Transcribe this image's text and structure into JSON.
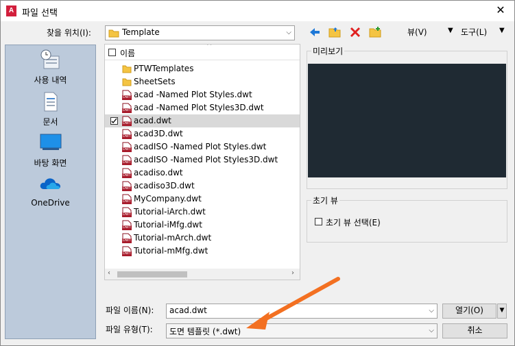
{
  "title": "파일 선택",
  "app_icon_text": "A",
  "lookin": {
    "label": "찾을 위치(I):",
    "value": "Template"
  },
  "toolbar": {
    "view_label": "뷰(V)",
    "tools_label": "도구(L)"
  },
  "sidebar": [
    {
      "label": "사용 내역",
      "icon": "history-icon"
    },
    {
      "label": "문서",
      "icon": "documents-icon"
    },
    {
      "label": "바탕 화면",
      "icon": "desktop-icon"
    },
    {
      "label": "OneDrive",
      "icon": "onedrive-icon"
    }
  ],
  "filelist": {
    "header": "이름",
    "items": [
      {
        "name": "PTWTemplates",
        "type": "folder",
        "checked": false,
        "selected": false
      },
      {
        "name": "SheetSets",
        "type": "folder",
        "checked": false,
        "selected": false
      },
      {
        "name": "acad -Named Plot Styles.dwt",
        "type": "dwt",
        "checked": false,
        "selected": false
      },
      {
        "name": "acad -Named Plot Styles3D.dwt",
        "type": "dwt",
        "checked": false,
        "selected": false
      },
      {
        "name": "acad.dwt",
        "type": "dwt",
        "checked": true,
        "selected": true
      },
      {
        "name": "acad3D.dwt",
        "type": "dwt",
        "checked": false,
        "selected": false
      },
      {
        "name": "acadISO -Named Plot Styles.dwt",
        "type": "dwt",
        "checked": false,
        "selected": false
      },
      {
        "name": "acadISO -Named Plot Styles3D.dwt",
        "type": "dwt",
        "checked": false,
        "selected": false
      },
      {
        "name": "acadiso.dwt",
        "type": "dwt",
        "checked": false,
        "selected": false
      },
      {
        "name": "acadiso3D.dwt",
        "type": "dwt",
        "checked": false,
        "selected": false
      },
      {
        "name": "MyCompany.dwt",
        "type": "dwt",
        "checked": false,
        "selected": false
      },
      {
        "name": "Tutorial-iArch.dwt",
        "type": "dwt",
        "checked": false,
        "selected": false
      },
      {
        "name": "Tutorial-iMfg.dwt",
        "type": "dwt",
        "checked": false,
        "selected": false
      },
      {
        "name": "Tutorial-mArch.dwt",
        "type": "dwt",
        "checked": false,
        "selected": false
      },
      {
        "name": "Tutorial-mMfg.dwt",
        "type": "dwt",
        "checked": false,
        "selected": false
      }
    ],
    "file_icon_text": "DWT"
  },
  "preview": {
    "label": "미리보기"
  },
  "initial_view": {
    "label": "초기 뷰",
    "checkbox_label": "초기 뷰 선택(E)"
  },
  "filename": {
    "label": "파일 이름(N):",
    "value": "acad.dwt"
  },
  "filetype": {
    "label": "파일 유형(T):",
    "value": "도면 템플릿 (*.dwt)"
  },
  "buttons": {
    "open": "열기(O)",
    "cancel": "취소"
  },
  "colors": {
    "sidebar": "#bccadb",
    "preview_bg": "#1f2a33",
    "arrow": "#f37021",
    "accent_blue": "#1e78d7"
  }
}
